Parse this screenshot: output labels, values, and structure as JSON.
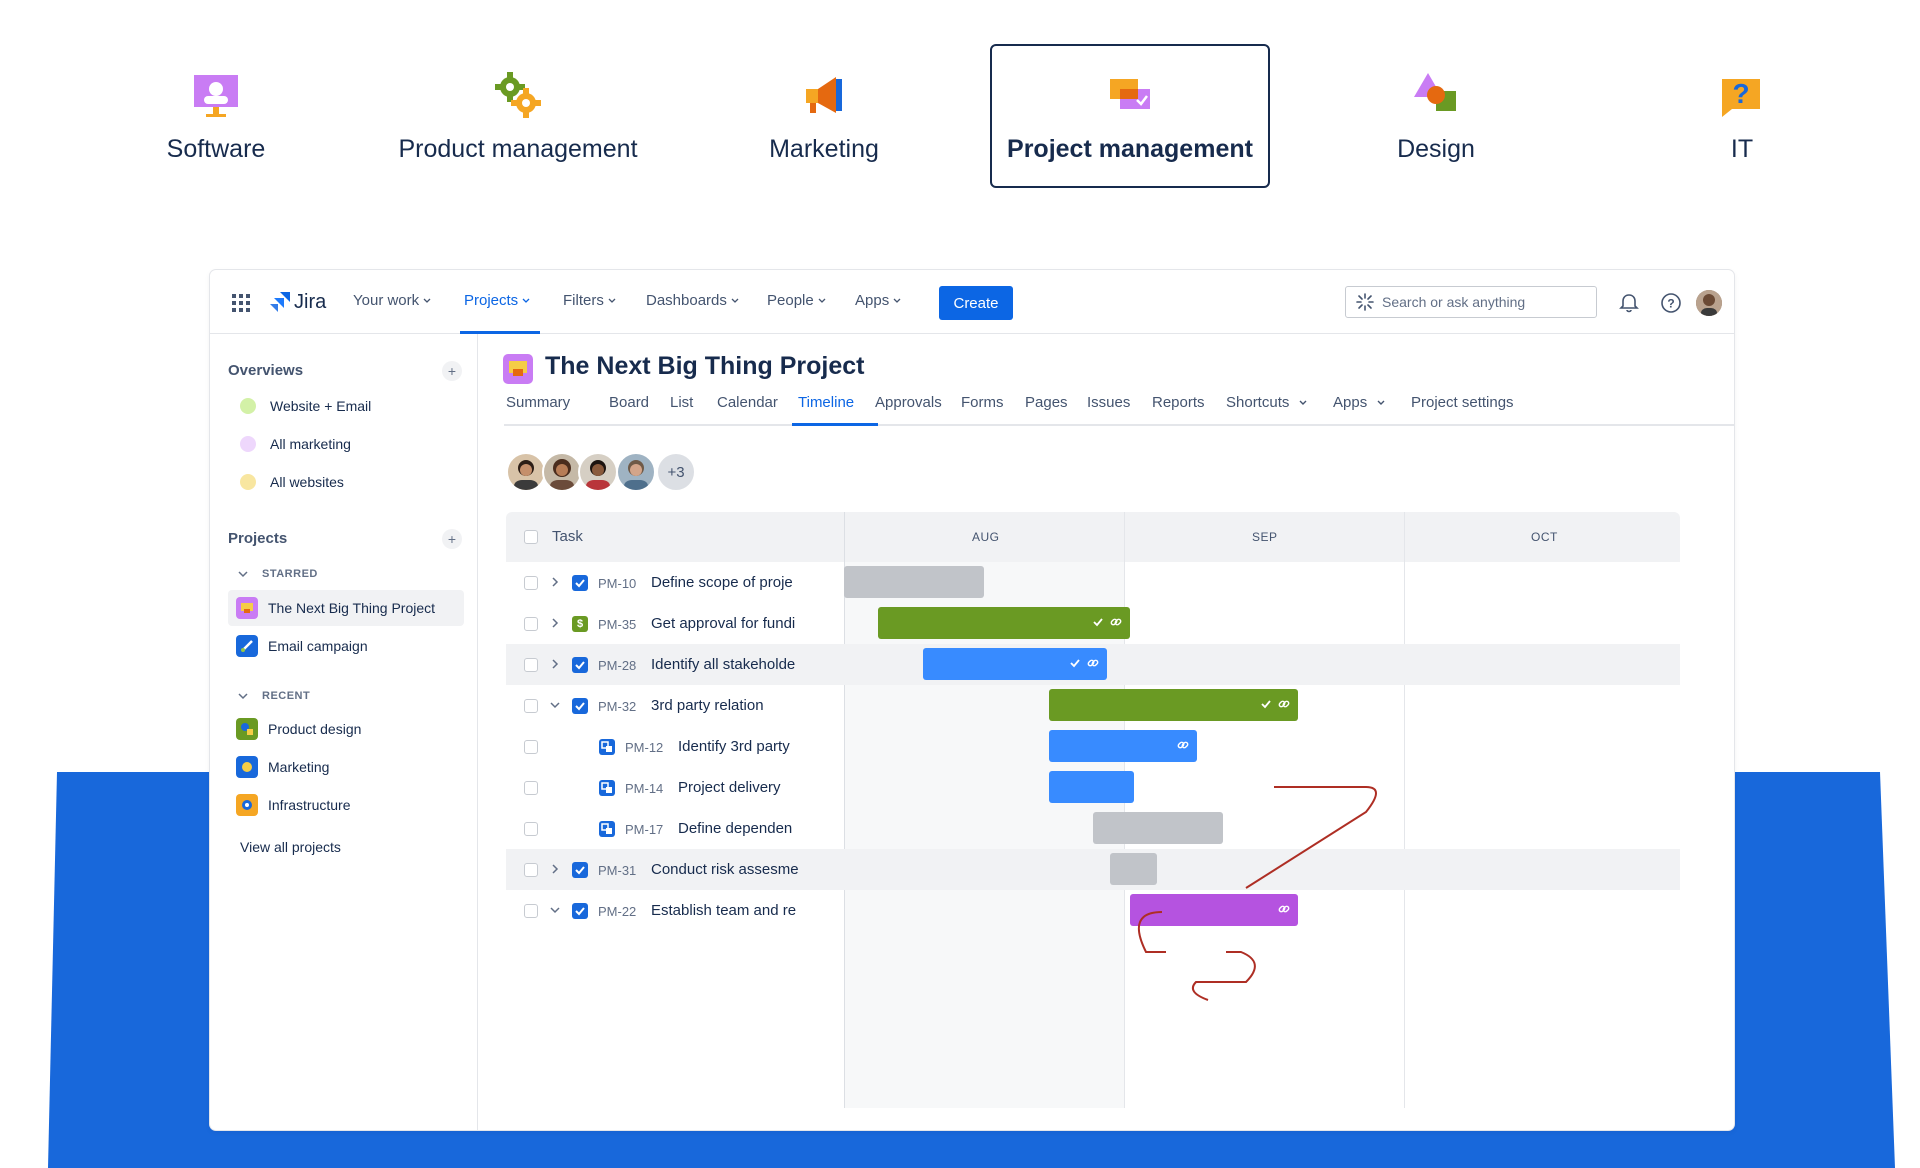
{
  "categories": [
    {
      "label": "Software",
      "icon": "monitor-icon",
      "active": false
    },
    {
      "label": "Product management",
      "icon": "gears-icon",
      "active": false
    },
    {
      "label": "Marketing",
      "icon": "megaphone-icon",
      "active": false
    },
    {
      "label": "Project management",
      "icon": "chat-boxes-icon",
      "active": true
    },
    {
      "label": "Design",
      "icon": "shapes-icon",
      "active": false
    },
    {
      "label": "IT",
      "icon": "help-bubble-icon",
      "active": false
    }
  ],
  "app": {
    "logo": "Jira",
    "nav": [
      "Your work",
      "Projects",
      "Filters",
      "Dashboards",
      "People",
      "Apps"
    ],
    "active_nav": "Projects",
    "create": "Create",
    "search_placeholder": "Search or ask anything"
  },
  "sidebar": {
    "overviews_title": "Overviews",
    "overviews": [
      {
        "label": "Website + Email",
        "color": "#94c748"
      },
      {
        "label": "All marketing",
        "color": "#c97cf4"
      },
      {
        "label": "All websites",
        "color": "#f5cd47"
      }
    ],
    "projects_title": "Projects",
    "starred_label": "STARRED",
    "starred": [
      {
        "label": "The Next Big Thing Project",
        "selected": true
      },
      {
        "label": "Email campaign",
        "selected": false
      }
    ],
    "recent_label": "RECENT",
    "recent": [
      {
        "label": "Product design"
      },
      {
        "label": "Marketing"
      },
      {
        "label": "Infrastructure"
      }
    ],
    "view_all": "View all projects"
  },
  "project": {
    "title": "The Next Big Thing Project",
    "tabs": [
      "Summary",
      "Board",
      "List",
      "Calendar",
      "Timeline",
      "Approvals",
      "Forms",
      "Pages",
      "Issues",
      "Reports",
      "Shortcuts",
      "Apps",
      "Project settings"
    ],
    "active_tab": "Timeline",
    "extra_people": "+3"
  },
  "timeline": {
    "task_header": "Task",
    "months": [
      "AUG",
      "SEP",
      "OCT"
    ],
    "rows": [
      {
        "key": "PM-10",
        "name": "Define scope of proje",
        "type": "task",
        "chevron": "right",
        "indent": 0,
        "bar_color": "#c1c4c9",
        "highlight": false
      },
      {
        "key": "PM-35",
        "name": "Get approval for fundi",
        "type": "budget",
        "chevron": "right",
        "indent": 0,
        "bar_color": "#6a9a23",
        "highlight": false
      },
      {
        "key": "PM-28",
        "name": "Identify all stakeholde",
        "type": "task",
        "chevron": "right",
        "indent": 0,
        "bar_color": "#388bff",
        "highlight": true
      },
      {
        "key": "PM-32",
        "name": "3rd party relation",
        "type": "task",
        "chevron": "down",
        "indent": 0,
        "bar_color": "#6a9a23",
        "highlight": false
      },
      {
        "key": "PM-12",
        "name": "Identify 3rd party",
        "type": "subtask",
        "chevron": "none",
        "indent": 1,
        "bar_color": "#388bff",
        "highlight": false
      },
      {
        "key": "PM-14",
        "name": "Project delivery",
        "type": "subtask",
        "chevron": "none",
        "indent": 1,
        "bar_color": "#388bff",
        "highlight": false
      },
      {
        "key": "PM-17",
        "name": "Define dependen",
        "type": "subtask",
        "chevron": "none",
        "indent": 1,
        "bar_color": "#c1c4c9",
        "highlight": false
      },
      {
        "key": "PM-31",
        "name": "Conduct risk assesme",
        "type": "task",
        "chevron": "right",
        "indent": 0,
        "bar_color": "#c1c4c9",
        "highlight": true
      },
      {
        "key": "PM-22",
        "name": "Establish team and re",
        "type": "task",
        "chevron": "down",
        "indent": 0,
        "bar_color": "#b553e0",
        "highlight": false
      }
    ]
  },
  "colors": {
    "brand_blue": "#0c66e4",
    "background_blue": "#1868db",
    "dependency_line": "#ae2e24"
  }
}
